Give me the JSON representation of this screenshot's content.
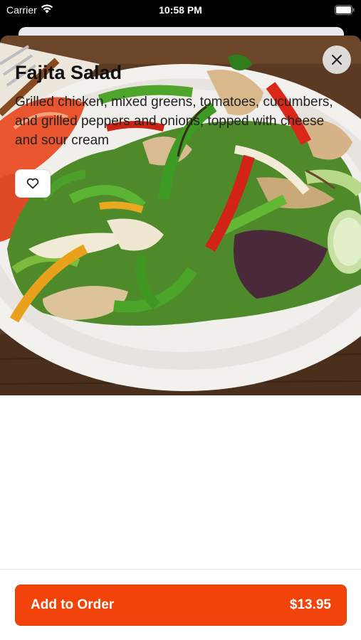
{
  "status_bar": {
    "carrier": "Carrier",
    "time": "10:58 PM",
    "wifi_icon": "wifi-icon",
    "battery_icon": "battery-icon"
  },
  "item": {
    "title": "Fajita Salad",
    "description": "Grilled chicken, mixed greens, tomatoes, cucumbers, and grilled peppers and onions, topped with cheese and sour cream",
    "image_icon": "salad-photo"
  },
  "actions": {
    "close_icon": "close-icon",
    "favorite_icon": "heart-icon",
    "add_label": "Add to Order",
    "price": "$13.95"
  },
  "colors": {
    "accent": "#f2440a",
    "text_primary": "#111111",
    "text_secondary": "#222222"
  }
}
